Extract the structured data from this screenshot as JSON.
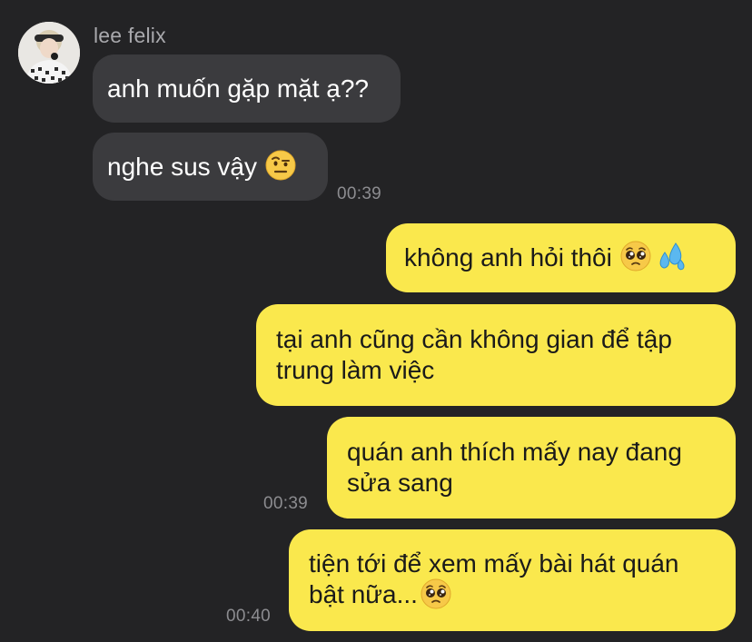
{
  "contact": {
    "name": "lee felix",
    "avatar_icon": "profile-photo-avatar"
  },
  "messages": [
    {
      "side": "in",
      "text": "anh muốn gặp mặt ạ??",
      "emoji": []
    },
    {
      "side": "in",
      "text": "nghe sus vậy",
      "emoji": [
        "raised-eyebrow-face"
      ],
      "time": "00:39"
    },
    {
      "side": "out",
      "text": "không anh hỏi thôi",
      "emoji": [
        "pleading-face",
        "sweat-droplets"
      ]
    },
    {
      "side": "out",
      "text": "tại anh cũng cần không gian để tập\ntrung làm việc",
      "emoji": []
    },
    {
      "side": "out",
      "text": "quán anh thích mấy nay đang\nsửa sang",
      "emoji": [],
      "time": "00:39"
    },
    {
      "side": "out",
      "text": "tiện tới để xem mấy bài hát quán\nbật nữa...",
      "emoji": [
        "pleading-face"
      ],
      "time": "00:40"
    }
  ],
  "colors": {
    "background": "#232325",
    "incoming_bubble": "#3b3b3e",
    "outgoing_bubble": "#fae84d",
    "timestamp": "#8c8c90",
    "name": "#a9a9ad"
  }
}
